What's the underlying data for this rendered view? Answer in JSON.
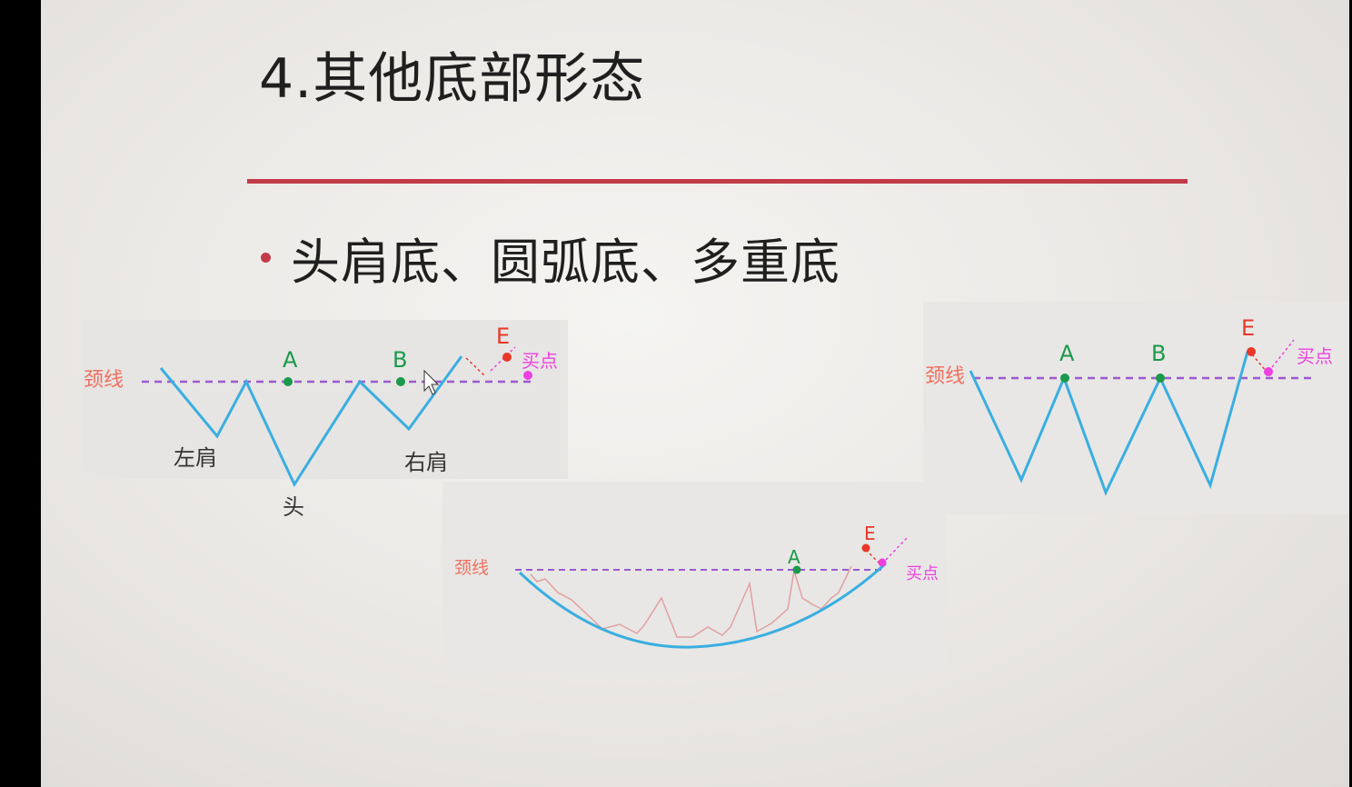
{
  "slide": {
    "title": "4.其他底部形态",
    "bullet": "头肩底、圆弧底、多重底"
  },
  "diagrams": {
    "head_shoulders": {
      "neckline_label": "颈线",
      "point_a": "A",
      "point_b": "B",
      "point_e": "E",
      "buy_label": "买点",
      "left_shoulder": "左肩",
      "head": "头",
      "right_shoulder": "右肩"
    },
    "round_bottom": {
      "neckline_label": "颈线",
      "point_a": "A",
      "point_e": "E",
      "buy_label": "买点"
    },
    "multiple_bottom": {
      "neckline_label": "颈线",
      "point_a": "A",
      "point_b": "B",
      "point_e": "E",
      "buy_label": "买点"
    }
  },
  "colors": {
    "accent_rule": "#c23a4a",
    "price_line": "#3aaee0",
    "neckline": "#9b59d0",
    "key_point": "#1a9a4a",
    "breakout_point": "#e8382a",
    "buy_point": "#ee3fe0",
    "round_bottom_price": "#e0a0a0"
  }
}
